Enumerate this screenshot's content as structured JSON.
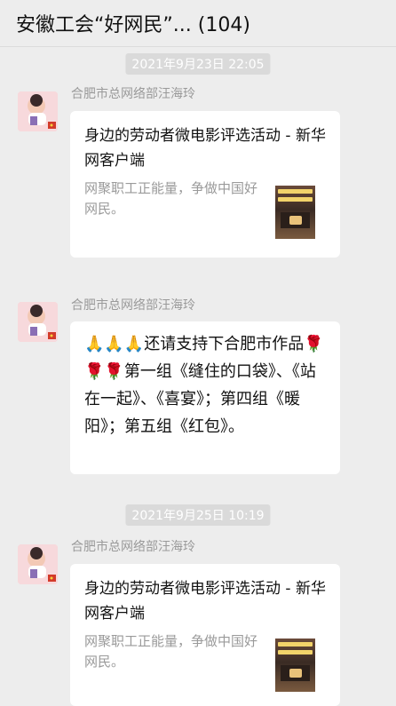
{
  "header": {
    "title": "安徽工会“好网民”... (104)"
  },
  "messages": [
    {
      "timestamp": "2021年9月23日 22:05",
      "sender": "合肥市总网络部汪海玲",
      "card": {
        "title": "身边的劳动者微电影评选活动 - 新华网客户端",
        "desc": "网聚职工正能量，争做中国好网民。"
      }
    },
    {
      "sender": "合肥市总网络部汪海玲",
      "text": "🙏🙏🙏还请支持下合肥市作品🌹🌹🌹第一组《缝住的口袋》、《站在一起》、《喜宴》；第四组《暖阳》；第五组《红包》。"
    },
    {
      "timestamp": "2021年9月25日 10:19",
      "sender": "合肥市总网络部汪海玲",
      "card": {
        "title": "身边的劳动者微电影评选活动 - 新华网客户端",
        "desc": "网聚职工正能量，争做中国好网民。"
      }
    }
  ]
}
